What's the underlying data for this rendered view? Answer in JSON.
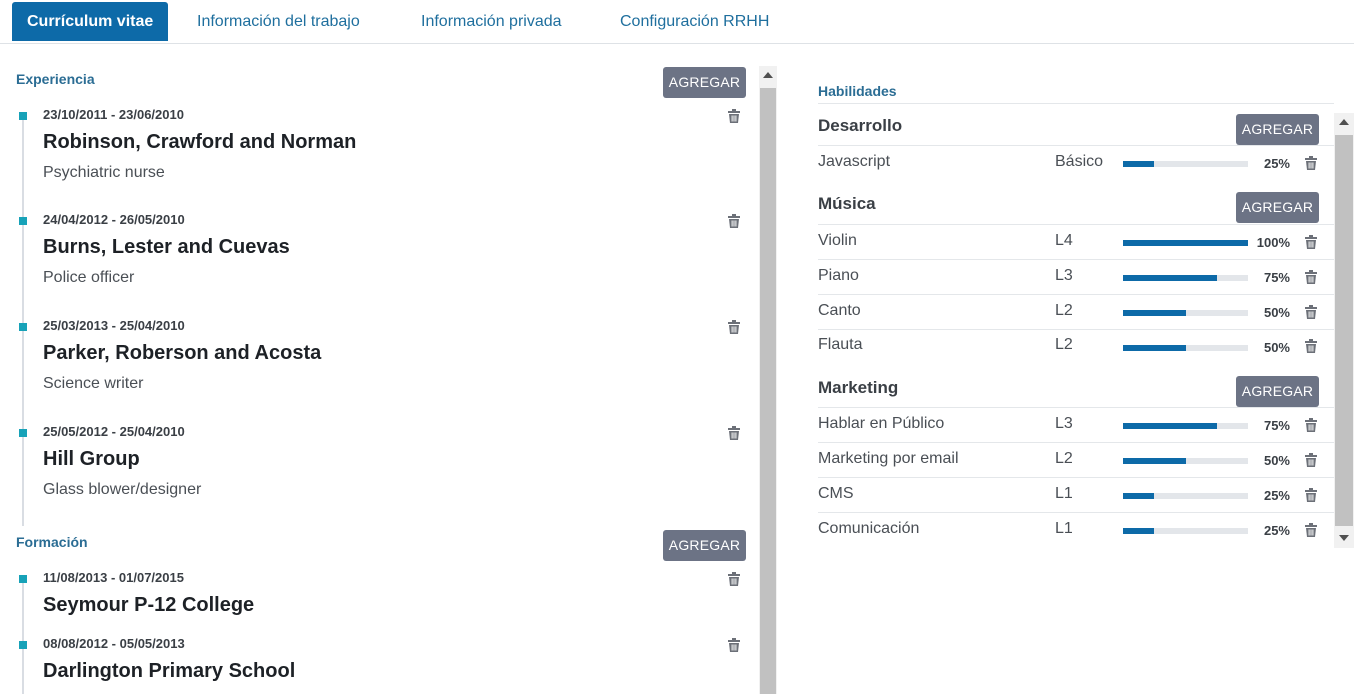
{
  "tabs": [
    {
      "label": "Currículum vitae",
      "active": true
    },
    {
      "label": "Información del trabajo",
      "active": false
    },
    {
      "label": "Información privada",
      "active": false
    },
    {
      "label": "Configuración RRHH",
      "active": false
    }
  ],
  "experience": {
    "title": "Experiencia",
    "add_label": "AGREGAR",
    "entries": [
      {
        "dates": "23/10/2011 - 23/06/2010",
        "org": "Robinson, Crawford and Norman",
        "role": "Psychiatric nurse"
      },
      {
        "dates": "24/04/2012 - 26/05/2010",
        "org": "Burns, Lester and Cuevas",
        "role": "Police officer"
      },
      {
        "dates": "25/03/2013 - 25/04/2010",
        "org": "Parker, Roberson and Acosta",
        "role": "Science writer"
      },
      {
        "dates": "25/05/2012 - 25/04/2010",
        "org": "Hill Group",
        "role": "Glass blower/designer"
      }
    ]
  },
  "education": {
    "title": "Formación",
    "add_label": "AGREGAR",
    "entries": [
      {
        "dates": "11/08/2013 - 01/07/2015",
        "org": "Seymour P-12 College"
      },
      {
        "dates": "08/08/2012 - 05/05/2013",
        "org": "Darlington Primary School"
      }
    ]
  },
  "skills": {
    "title": "Habilidades",
    "add_label": "AGREGAR",
    "groups": [
      {
        "name": "Desarrollo",
        "items": [
          {
            "name": "Javascript",
            "level": "Básico",
            "progress": 25,
            "pct": "25%"
          }
        ]
      },
      {
        "name": "Música",
        "items": [
          {
            "name": "Violin",
            "level": "L4",
            "progress": 100,
            "pct": "100%"
          },
          {
            "name": "Piano",
            "level": "L3",
            "progress": 75,
            "pct": "75%"
          },
          {
            "name": "Canto",
            "level": "L2",
            "progress": 50,
            "pct": "50%"
          },
          {
            "name": "Flauta",
            "level": "L2",
            "progress": 50,
            "pct": "50%"
          }
        ]
      },
      {
        "name": "Marketing",
        "items": [
          {
            "name": "Hablar en Público",
            "level": "L3",
            "progress": 75,
            "pct": "75%"
          },
          {
            "name": "Marketing por email",
            "level": "L2",
            "progress": 50,
            "pct": "50%"
          },
          {
            "name": "CMS",
            "level": "L1",
            "progress": 25,
            "pct": "25%"
          },
          {
            "name": "Comunicación",
            "level": "L1",
            "progress": 25,
            "pct": "25%"
          }
        ]
      }
    ]
  },
  "icons": {
    "delete": "trash-icon"
  },
  "colors": {
    "accent": "#0d6aa8",
    "timeline_dot": "#17a2b8",
    "button": "#6c7385"
  }
}
